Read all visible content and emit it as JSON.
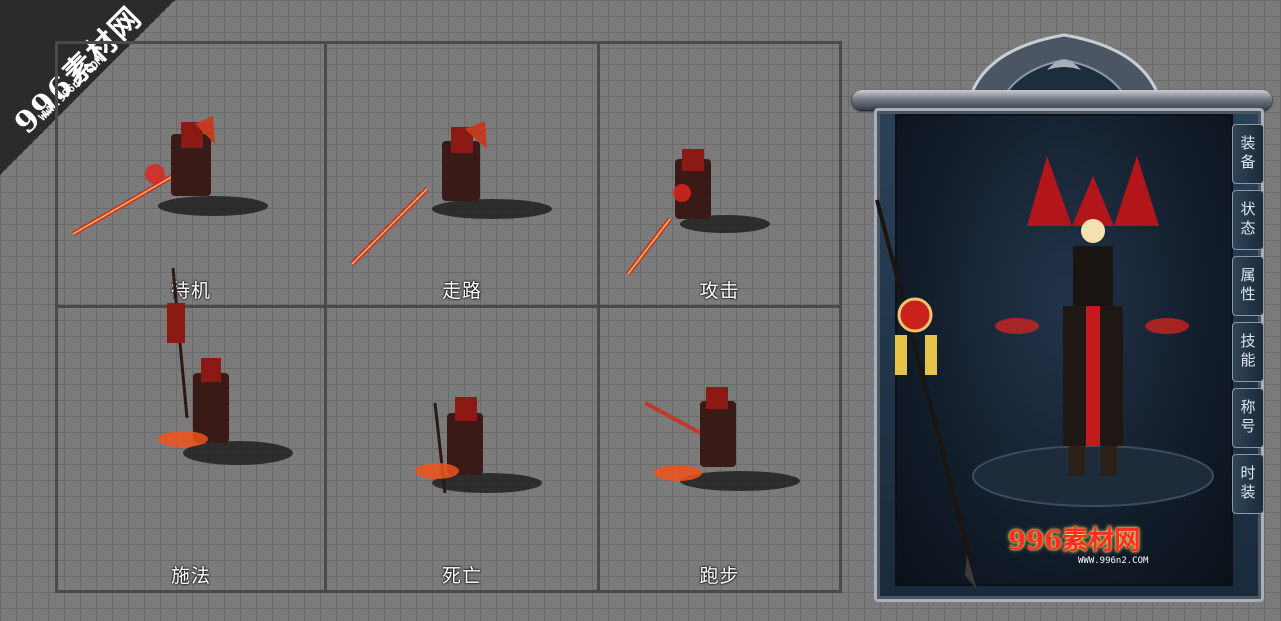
{
  "watermark": {
    "brand": "996素材网",
    "url": "WWW.996n2.COM"
  },
  "actions": [
    {
      "label": "待机"
    },
    {
      "label": "走路"
    },
    {
      "label": "攻击"
    },
    {
      "label": "施法"
    },
    {
      "label": "死亡"
    },
    {
      "label": "跑步"
    }
  ],
  "panel": {
    "tabs": [
      "装备",
      "状态",
      "属性",
      "技能",
      "称号",
      "时装"
    ],
    "logo": "996素材网",
    "logo_url": "WWW.996n2.COM"
  },
  "colors": {
    "background": "#7b7b7b",
    "grid_line": "#4a4a4a",
    "accent_red": "#d4161e",
    "panel_blue": "#1a2a3b"
  }
}
